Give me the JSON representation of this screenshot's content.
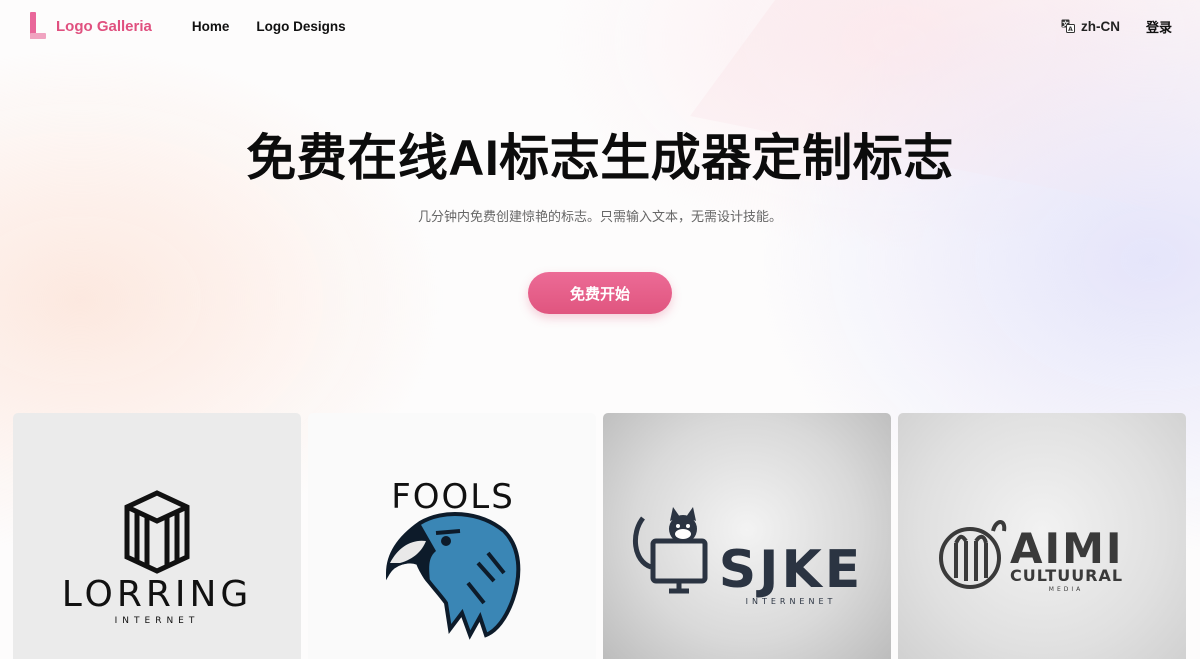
{
  "brand": {
    "name": "Logo Galleria",
    "accent": "#e0507f"
  },
  "nav": {
    "items": [
      {
        "label": "Home"
      },
      {
        "label": "Logo Designs"
      }
    ]
  },
  "lang": {
    "label": "zh-CN",
    "icon": "translate-icon"
  },
  "auth": {
    "login_label": "登录"
  },
  "hero": {
    "title": "免费在线AI标志生成器定制标志",
    "subtitle": "几分钟内免费创建惊艳的标志。只需输入文本，无需设计技能。",
    "cta_label": "免费开始",
    "cta_color": "#e0557f"
  },
  "gallery": {
    "cards": [
      {
        "name": "LORRING",
        "tagline": "INTERNET",
        "icon": "cube-monogram-icon"
      },
      {
        "name": "FOOLS",
        "icon": "eagle-head-icon",
        "color": "#3a86b5"
      },
      {
        "name": "SJKE",
        "tagline": "INTERNENET",
        "icon": "cat-on-monitor-icon"
      },
      {
        "name": "AIMI",
        "tagline": "CULTUURAL",
        "subtagline": "MEDIA",
        "icon": "circle-monogram-icon"
      }
    ]
  }
}
